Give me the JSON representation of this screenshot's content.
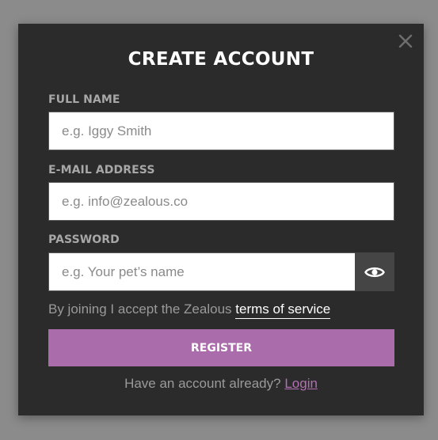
{
  "modal": {
    "title": "CREATE ACCOUNT",
    "close_icon": "close-icon"
  },
  "form": {
    "full_name": {
      "label": "FULL NAME",
      "placeholder": "e.g. Iggy Smith",
      "value": ""
    },
    "email": {
      "label": "E-MAIL ADDRESS",
      "placeholder": "e.g. info@zealous.co",
      "value": ""
    },
    "password": {
      "label": "PASSWORD",
      "placeholder": "e.g. Your pet’s name",
      "value": "",
      "toggle_icon": "eye-icon"
    },
    "terms_prefix": "By joining I accept the Zealous",
    "terms_link": "terms of service",
    "register_label": "REGISTER",
    "login_prompt": "Have an account already?",
    "login_link": "Login"
  },
  "colors": {
    "accent": "#ab6cab",
    "link": "#b36fb3",
    "modal_bg": "#2b2b2b",
    "overlay_bg": "#8b8b8b"
  }
}
